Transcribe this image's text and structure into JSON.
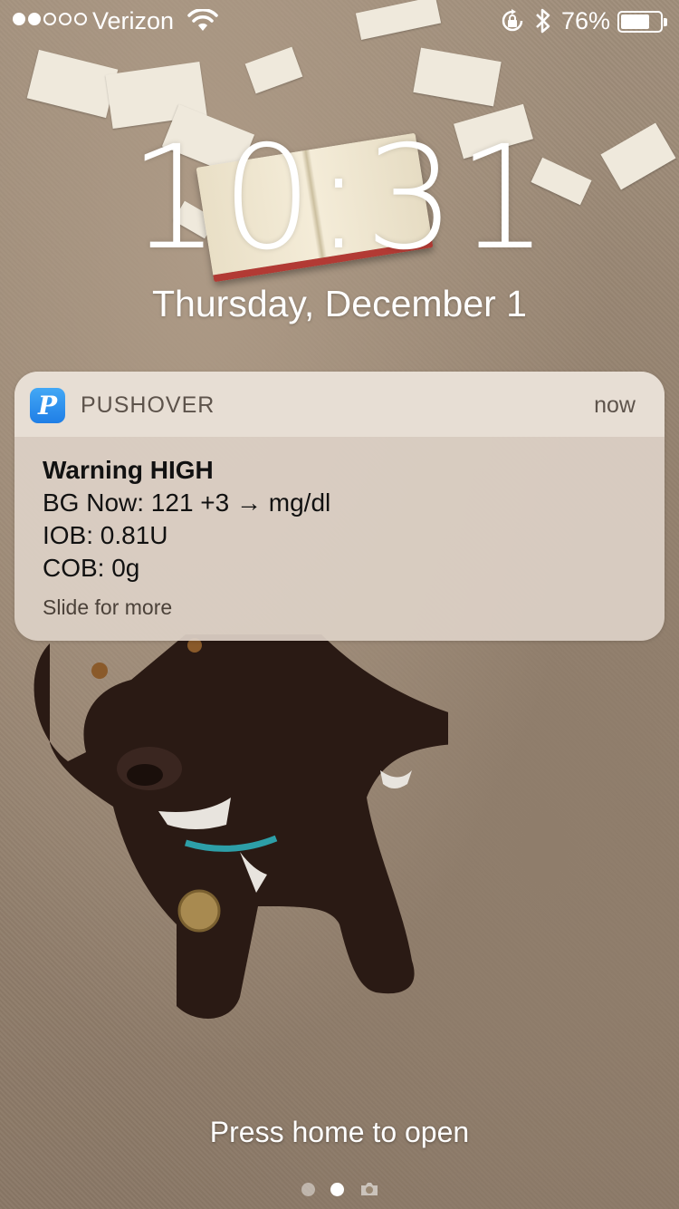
{
  "status_bar": {
    "carrier": "Verizon",
    "signal_bars_filled": 2,
    "signal_bars_total": 5,
    "battery_percent": "76%",
    "battery_level": 0.76,
    "icons": [
      "wifi-icon",
      "rotation-lock-icon",
      "bluetooth-icon",
      "battery-icon"
    ]
  },
  "lock_screen": {
    "time": "10:31",
    "date": "Thursday, December 1"
  },
  "notification": {
    "app_icon_glyph": "P",
    "app_name": "PUSHOVER",
    "time": "now",
    "title": "Warning HIGH",
    "lines": [
      "BG Now: 121 +3 → mg/dl",
      "IOB: 0.81U",
      "COB: 0g"
    ],
    "hint": "Slide for more"
  },
  "footer": {
    "prompt": "Press home to open",
    "pages": 2,
    "active_page": 2,
    "camera_icon": "camera-icon"
  },
  "colors": {
    "app_icon_blue": "#2c8ff0",
    "notification_bg": "#ddd1c6"
  }
}
